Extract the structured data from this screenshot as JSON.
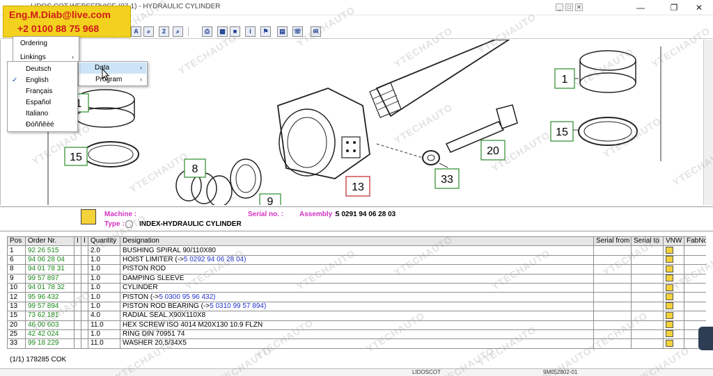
{
  "window": {
    "title": "LIDOS COT WEBSERVICE (07-1) - HYDRAULIC CYLINDER",
    "min_label": "—",
    "max_label": "❐",
    "close_label": "✕",
    "tiny_min": "_",
    "tiny_max": "□",
    "tiny_close": "✕"
  },
  "overlay": {
    "email": "Eng.M.Diab@live.com",
    "phone": "+2 0100 88 75 968"
  },
  "watermark": "YTECHAUTO",
  "toolbar": {
    "buttons": [
      {
        "icon": "a-circle-icon",
        "glyph": "A"
      },
      {
        "icon": "search-icon",
        "glyph": "⌕"
      },
      {
        "icon": "two-circle-icon",
        "glyph": "2"
      },
      {
        "icon": "search-plus-icon",
        "glyph": "⌕"
      },
      {
        "icon": "printer-icon",
        "glyph": "⎙"
      },
      {
        "icon": "grid-icon",
        "glyph": "▦"
      },
      {
        "icon": "blue-square-icon",
        "glyph": "■"
      },
      {
        "icon": "info-icon",
        "glyph": "i"
      },
      {
        "icon": "flag-icon",
        "glyph": "⚑"
      },
      {
        "icon": "book-icon",
        "glyph": "▤"
      },
      {
        "icon": "contact-icon",
        "glyph": "☏"
      },
      {
        "icon": "mail-icon",
        "glyph": "✉"
      }
    ]
  },
  "menus": {
    "main": {
      "items": [
        {
          "label": "Ordering",
          "arrow": ""
        },
        {
          "label": "Linkings",
          "arrow": "›"
        }
      ]
    },
    "language": {
      "items": [
        {
          "label": "Deutsch",
          "checked": false
        },
        {
          "label": "English",
          "checked": true
        },
        {
          "label": "Français",
          "checked": false
        },
        {
          "label": "Español",
          "checked": false
        },
        {
          "label": "Italiano",
          "checked": false
        },
        {
          "label": "Ðóññêèé",
          "checked": false
        }
      ],
      "check_glyph": "✓"
    },
    "sub": {
      "items": [
        {
          "label": "Data",
          "arrow": "›"
        },
        {
          "label": "Program",
          "arrow": "›"
        }
      ]
    }
  },
  "drawing": {
    "callouts": [
      "1",
      "15",
      "8",
      "13",
      "33",
      "20",
      "1",
      "15",
      "9"
    ]
  },
  "info": {
    "machine_label": "Machine :",
    "machine_value": "",
    "serial_label": "Serial no. :",
    "serial_value": "",
    "assembly_label": "Assembly :",
    "assembly_value": "5 0291 94 06 28 03",
    "type_label": "Type :",
    "type_value": "INDEX-HYDRAULIC CYLINDER"
  },
  "table": {
    "columns": [
      "Pos",
      "Order Nr.",
      "I",
      "I",
      "Quantity",
      "Designation",
      "Serial from",
      "Serial to",
      "VNW",
      "FabNo"
    ],
    "rows": [
      {
        "pos": "1",
        "order": "92 26 515",
        "qty": "2.0",
        "desig": "BUSHING SPIRAL 90/110X80",
        "ref": ""
      },
      {
        "pos": "6",
        "order": "94 06 28 04",
        "qty": "1.0",
        "desig": "HOIST LIMITER (->",
        "ref": "5 0292 94 06 28 04)"
      },
      {
        "pos": "8",
        "order": "94 01 78 31",
        "qty": "1.0",
        "desig": "PISTON ROD",
        "ref": ""
      },
      {
        "pos": "9",
        "order": "99 57 897",
        "qty": "1.0",
        "desig": "DAMPING SLEEVE",
        "ref": ""
      },
      {
        "pos": "10",
        "order": "94 01 78 32",
        "qty": "1.0",
        "desig": "CYLINDER",
        "ref": ""
      },
      {
        "pos": "12",
        "order": "95 96 432",
        "qty": "1.0",
        "desig": "PISTON (->",
        "ref": "5 0300 95 96 432)"
      },
      {
        "pos": "13",
        "order": "99 57 894",
        "qty": "1.0",
        "desig": "PISTON ROD BEARING (->",
        "ref": "5 0310 99 57 894)"
      },
      {
        "pos": "15",
        "order": "73 62 181",
        "qty": "4.0",
        "desig": "RADIAL SEAL X90X110X8",
        "ref": ""
      },
      {
        "pos": "20",
        "order": "46 00 603",
        "qty": "11.0",
        "desig": "HEX SCREW ISO 4014 M20X130 10.9 FLZN",
        "ref": ""
      },
      {
        "pos": "25",
        "order": "42 42 024",
        "qty": "1.0",
        "desig": "RING DIN 70951 74",
        "ref": ""
      },
      {
        "pos": "33",
        "order": "99 18 229",
        "qty": "11.0",
        "desig": "WASHER 20,5/34X5",
        "ref": ""
      }
    ],
    "count_text": "(1/1) 178285 COK"
  },
  "status": {
    "left": "LIDOSCOT",
    "right": "9M052802-01"
  },
  "colors": {
    "accent_magenta": "#d232c3",
    "order_green": "#1a8a1a",
    "link_blue": "#2233cc",
    "overlay_yellow": "#f2d21e",
    "overlay_red": "#d11a1a",
    "callout_green": "#2a8a2a",
    "callout_red": "#c02020"
  }
}
